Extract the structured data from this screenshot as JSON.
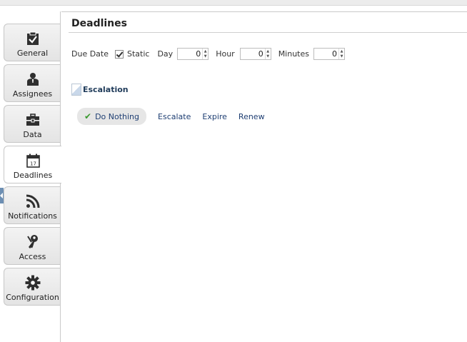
{
  "sidebar": {
    "tabs": [
      {
        "label": "General",
        "icon": "clipboard-check-icon"
      },
      {
        "label": "Assignees",
        "icon": "user-icon"
      },
      {
        "label": "Data",
        "icon": "briefcase-icon"
      },
      {
        "label": "Deadlines",
        "icon": "calendar-icon",
        "active": true,
        "icon_text": "17"
      },
      {
        "label": "Notifications",
        "icon": "rss-icon"
      },
      {
        "label": "Access",
        "icon": "keys-icon"
      },
      {
        "label": "Configuration",
        "icon": "gear-icon"
      }
    ]
  },
  "main": {
    "title": "Deadlines",
    "due_date": {
      "label": "Due Date",
      "static_label": "Static",
      "static_checked": true,
      "day_label": "Day",
      "day_value": "0",
      "hour_label": "Hour",
      "hour_value": "0",
      "minutes_label": "Minutes",
      "minutes_value": "0"
    },
    "escalation": {
      "title": "Escalation",
      "actions": [
        {
          "label": "Do Nothing",
          "selected": true
        },
        {
          "label": "Escalate",
          "selected": false
        },
        {
          "label": "Expire",
          "selected": false
        },
        {
          "label": "Renew",
          "selected": false
        }
      ]
    }
  },
  "colors": {
    "link": "#1f3f73",
    "check": "#3a9a2f",
    "icon": "#2f2f2f"
  }
}
